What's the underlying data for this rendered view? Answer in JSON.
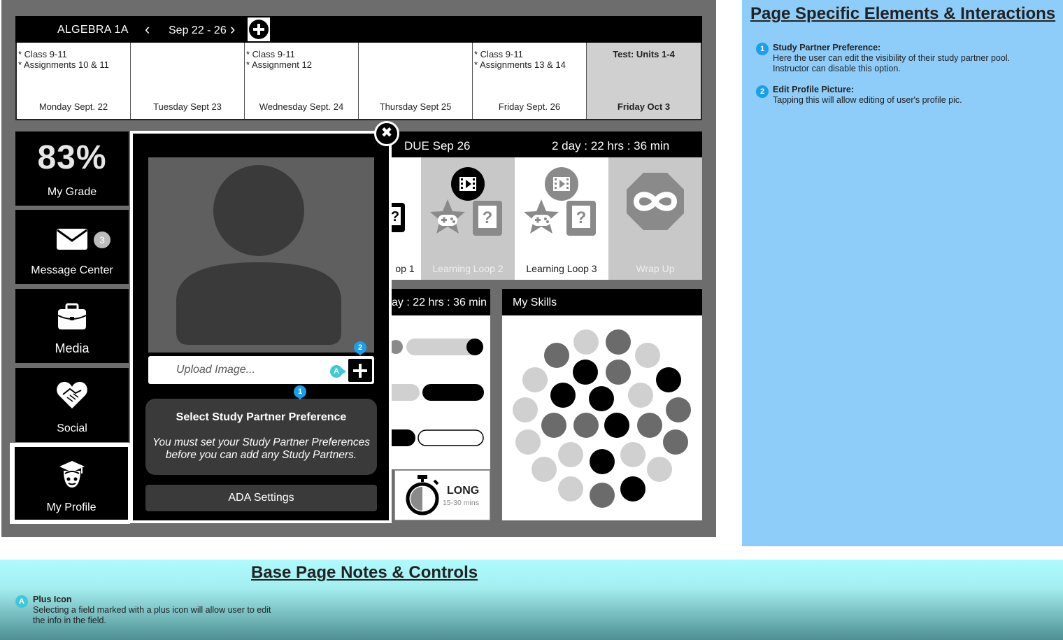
{
  "calendar": {
    "course": "ALGEBRA 1A",
    "prev_icon": "‹",
    "next_icon": "›",
    "week_range": "Sep 22 - 26",
    "days": [
      {
        "events": "* Class 9-11\n* Assignments 10 & 11",
        "name": "Monday Sept. 22"
      },
      {
        "events": "",
        "name": "Tuesday Sept 23"
      },
      {
        "events": "* Class 9-11\n* Assignment 12",
        "name": "Wednesday Sept. 24"
      },
      {
        "events": "",
        "name": "Thursday Sept 25"
      },
      {
        "events": "* Class 9-11\n* Assignments 13 & 14",
        "name": "Friday  Sept. 26"
      },
      {
        "events": "Test: Units 1-4",
        "name": "Friday Oct 3"
      }
    ]
  },
  "nav": {
    "grade_value": "83%",
    "grade_label": "My Grade",
    "message_label": "Message Center",
    "message_count": "3",
    "media_label": "Media",
    "social_label": "Social",
    "profile_label": "My Profile"
  },
  "assignment": {
    "due_date": "DUE Sep 26",
    "countdown": "2 day :  22 hrs : 36 min",
    "loops": [
      {
        "label": "op 1"
      },
      {
        "label": "Learning Loop 2"
      },
      {
        "label": "Learning Loop 3"
      },
      {
        "label": "Wrap Up"
      }
    ]
  },
  "progress": {
    "countdown": "ay :  22 hrs : 36 min",
    "long_title": "LONG",
    "long_sub": "15-30 mins"
  },
  "skills": {
    "title": "My Skills"
  },
  "modal": {
    "close_icon": "✖",
    "upload_placeholder": "Upload Image...",
    "pref_title": "Select Study Partner Preference",
    "pref_message": "You must set your Study Partner Preferences\nbefore you can add any Study Partners.",
    "ada_label": "ADA Settings"
  },
  "markers": {
    "one": "1",
    "two": "2",
    "a": "A"
  },
  "notes": {
    "title": "Page Specific Elements & Interactions",
    "items": [
      {
        "num": "1",
        "title": "Study Partner Preference:",
        "desc": "Here the user can edit the visibility of their study partner pool.\nInstructor can disable this option."
      },
      {
        "num": "2",
        "title": "Edit Profile Picture:",
        "desc": "Tapping this will allow editing of user's profile pic."
      }
    ]
  },
  "base": {
    "title": "Base Page Notes & Controls",
    "marker": "A",
    "note_title": "Plus Icon",
    "note_desc": "Selecting a field marked with a plus icon will allow user to edit\nthe info in the field."
  },
  "colors": {
    "canvas": "#6d6d6d",
    "notes_bg": "#8ecdf9",
    "marker_blue": "#1a9fef",
    "marker_teal": "#3fc9d6"
  }
}
